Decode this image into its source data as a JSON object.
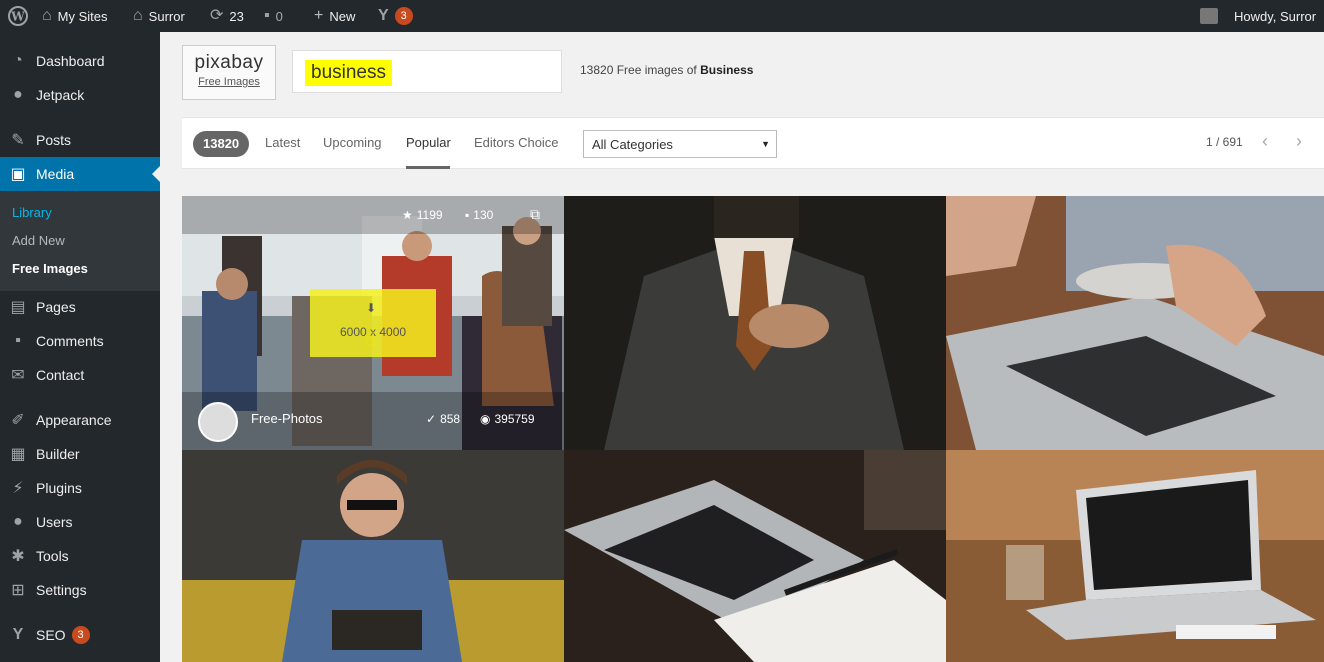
{
  "adminbar": {
    "my_sites": "My Sites",
    "site_name": "Surror",
    "updates_count": "23",
    "comments_count": "0",
    "new_label": "New",
    "yoast_count": "3",
    "howdy": "Howdy, Surror"
  },
  "sidebar": {
    "items": [
      {
        "label": "Dashboard",
        "icon": "dashboard-icon"
      },
      {
        "label": "Jetpack",
        "icon": "jetpack-icon"
      },
      {
        "label": "Posts",
        "icon": "pin-icon"
      },
      {
        "label": "Media",
        "icon": "media-icon"
      },
      {
        "label": "Pages",
        "icon": "page-icon"
      },
      {
        "label": "Comments",
        "icon": "comment-icon"
      },
      {
        "label": "Contact",
        "icon": "mail-icon"
      },
      {
        "label": "Appearance",
        "icon": "brush-icon"
      },
      {
        "label": "Builder",
        "icon": "builder-icon"
      },
      {
        "label": "Plugins",
        "icon": "plug-icon"
      },
      {
        "label": "Users",
        "icon": "user-icon"
      },
      {
        "label": "Tools",
        "icon": "wrench-icon"
      },
      {
        "label": "Settings",
        "icon": "settings-icon"
      },
      {
        "label": "SEO",
        "icon": "yoast-icon"
      }
    ],
    "submenu": [
      "Library",
      "Add New",
      "Free Images"
    ],
    "seo_badge": "3"
  },
  "header": {
    "logo": "pixabay",
    "logo_sub": "Free Images",
    "search_value": "business",
    "result_prefix": "13820 Free images of",
    "result_query": "Business"
  },
  "tabs": {
    "count": "13820",
    "items": [
      "Latest",
      "Upcoming",
      "Popular",
      "Editors Choice"
    ],
    "active": "Popular",
    "category": "All Categories",
    "page": "1 / 691"
  },
  "first_image": {
    "favorites": "1199",
    "comments": "130",
    "user": "Free-Photos",
    "likes": "858",
    "views": "395759",
    "resolution": "6000 x 4000"
  },
  "colors": {
    "admin_dark": "#23282d",
    "accent_blue": "#0073aa",
    "highlight_yellow": "#ffff00",
    "badge_orange": "#ca4a1f"
  }
}
